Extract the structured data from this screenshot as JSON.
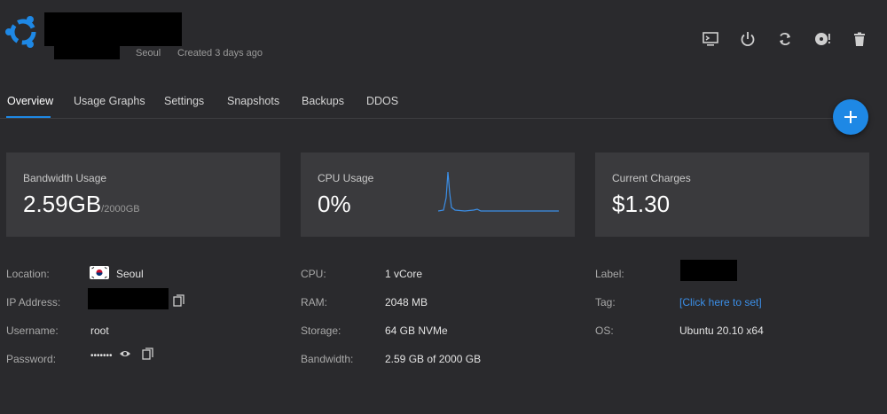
{
  "header": {
    "location": "Seoul",
    "created": "Created 3 days ago"
  },
  "toolbar": {
    "icons": [
      "console-icon",
      "power-icon",
      "restart-icon",
      "iso-icon",
      "trash-icon"
    ]
  },
  "tabs": [
    {
      "label": "Overview",
      "active": true
    },
    {
      "label": "Usage Graphs"
    },
    {
      "label": "Settings"
    },
    {
      "label": "Snapshots"
    },
    {
      "label": "Backups"
    },
    {
      "label": "DDOS"
    }
  ],
  "fab": {
    "icon": "plus-icon"
  },
  "cards": {
    "bandwidth": {
      "label": "Bandwidth Usage",
      "value": "2.59GB",
      "sub": "/2000GB"
    },
    "cpu": {
      "label": "CPU Usage",
      "value": "0%"
    },
    "charges": {
      "label": "Current Charges",
      "value": "$1.30"
    }
  },
  "info": {
    "location_label": "Location:",
    "location_value": "Seoul",
    "ip_label": "IP Address:",
    "username_label": "Username:",
    "username_value": "root",
    "password_label": "Password:",
    "password_value": "•••••••",
    "cpu_label": "CPU:",
    "cpu_value": "1 vCore",
    "ram_label": "RAM:",
    "ram_value": "2048 MB",
    "storage_label": "Storage:",
    "storage_value": "64 GB NVMe",
    "bandwidth_label": "Bandwidth:",
    "bandwidth_value": "2.59 GB of 2000 GB",
    "label_label": "Label:",
    "tag_label": "Tag:",
    "tag_value": "[Click here to set]",
    "os_label": "OS:",
    "os_value": "Ubuntu 20.10 x64"
  },
  "colors": {
    "background": "#2a2a2d",
    "card": "#3a3a3d",
    "accent": "#1e88e5",
    "link": "#3b8fe8"
  }
}
